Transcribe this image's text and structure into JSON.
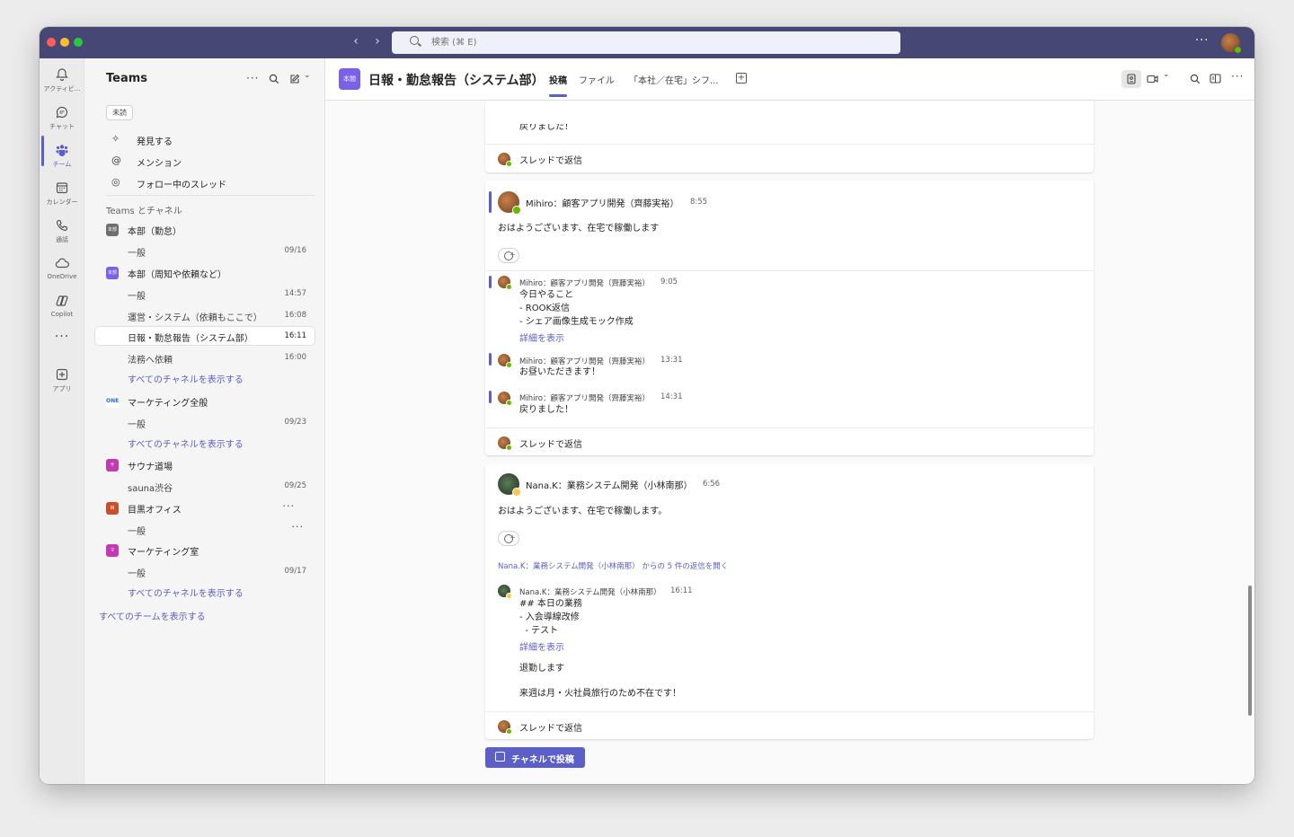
{
  "search": {
    "placeholder": "検索 (⌘ E)"
  },
  "rail": {
    "items": [
      {
        "label": "アクティビ..."
      },
      {
        "label": "チャット"
      },
      {
        "label": "チーム"
      },
      {
        "label": "カレンダー"
      },
      {
        "label": "通話"
      },
      {
        "label": "OneDrive"
      },
      {
        "label": "Copilot"
      },
      {
        "label": "アプリ"
      }
    ]
  },
  "sidebar": {
    "title": "Teams",
    "filter_chip": "未読",
    "links": [
      {
        "label": "発見する"
      },
      {
        "label": "メンション"
      },
      {
        "label": "フォロー中のスレッド"
      }
    ],
    "section_label": "Teams とチャネル",
    "teams": [
      {
        "badge": "本部",
        "name": "本部（勤怠）",
        "color": "#6e6e6e"
      },
      {
        "badge": "本部",
        "name": "本部（周知や依頼など）",
        "color": "#7b61e8"
      },
      {
        "badge": "ONE",
        "name": "マーケティング全般",
        "color": "#1f6fc5"
      },
      {
        "badge": "サ",
        "name": "サウナ道場",
        "color": "#c239b3"
      },
      {
        "badge": "目",
        "name": "目黒オフィス",
        "color": "#c94f2a"
      },
      {
        "badge": "マ",
        "name": "マーケティング室",
        "color": "#c239b3"
      }
    ],
    "channels": {
      "kintai_general": {
        "name": "一般",
        "time": "09/16"
      },
      "shuchi_general": {
        "name": "一般",
        "time": "14:57"
      },
      "unei": {
        "name": "運営・システム（依頼もここで）",
        "time": "16:08"
      },
      "nippo": {
        "name": "日報・勤怠報告（システム部）",
        "time": "16:11"
      },
      "houmu": {
        "name": "法務へ依頼",
        "time": "16:00"
      },
      "mkt_general": {
        "name": "一般",
        "time": "09/23"
      },
      "sauna": {
        "name": "sauna渋谷",
        "time": "09/25"
      },
      "meguro_general": {
        "name": "一般"
      },
      "mktroom_general": {
        "name": "一般",
        "time": "09/17"
      }
    },
    "show_all_channels": "すべてのチャネルを表示する",
    "show_all_teams": "すべてのチームを表示する"
  },
  "header": {
    "badge": "本間",
    "title": "日報・勤怠報告（システム部）",
    "tabs": [
      {
        "label": "投稿"
      },
      {
        "label": "ファイル"
      },
      {
        "label": "「本社／在宅」シフ..."
      }
    ]
  },
  "feed": {
    "reply_label": "スレッドで返信",
    "top_partial_text": "戻りました！",
    "post1": {
      "author": "Mihiro：顧客アプリ開発（齊藤実裕）",
      "time": "8:55",
      "body": "おはようございます、在宅で稼働します",
      "replies": [
        {
          "author": "Mihiro：顧客アプリ開発（齊藤実裕）",
          "time": "9:05",
          "lines": [
            "今日やること",
            "- ROOK返信",
            "- シェア画像生成モック作成"
          ],
          "more": "詳細を表示"
        },
        {
          "author": "Mihiro：顧客アプリ開発（齊藤実裕）",
          "time": "13:31",
          "lines": [
            "お昼いただきます！"
          ]
        },
        {
          "author": "Mihiro：顧客アプリ開発（齊藤実裕）",
          "time": "14:31",
          "lines": [
            "戻りました！"
          ]
        }
      ]
    },
    "post2": {
      "author": "Nana.K：業務システム開発（小林南那）",
      "time": "6:56",
      "body": "おはようございます、在宅で稼働します。",
      "open_replies": "Nana.K：業務システム開発（小林南那） からの 5 件の返信を開く",
      "reply": {
        "author": "Nana.K：業務システム開発（小林南那）",
        "time": "16:11",
        "lines": [
          "## 本日の業務",
          "- 入会導線改修",
          "  - テスト"
        ],
        "more": "詳細を表示",
        "extra1": "退勤します",
        "extra2": "来週は月・火社員旅行のため不在です！"
      }
    }
  },
  "post_button": "チャネルで投稿"
}
